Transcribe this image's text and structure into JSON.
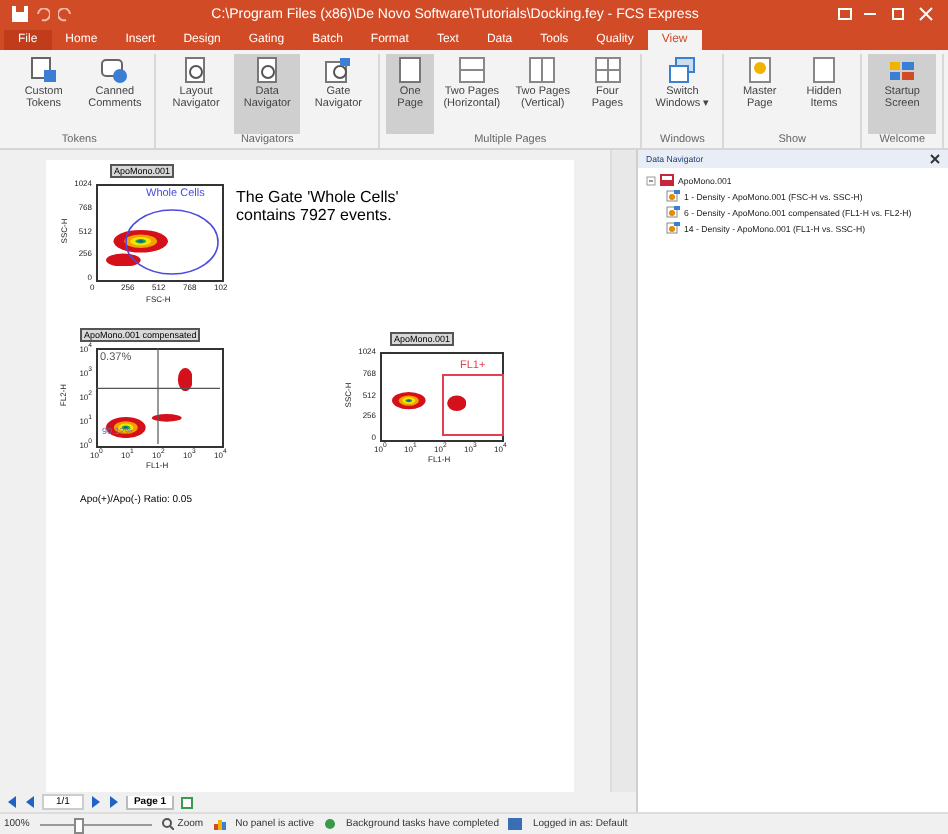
{
  "window": {
    "title": "C:\\Program Files (x86)\\De Novo Software\\Tutorials\\Docking.fey - FCS Express"
  },
  "ribbon_tabs": [
    {
      "label": "File",
      "selected": false
    },
    {
      "label": "Home",
      "selected": false
    },
    {
      "label": "Insert",
      "selected": false
    },
    {
      "label": "Design",
      "selected": false
    },
    {
      "label": "Gating",
      "selected": false
    },
    {
      "label": "Batch",
      "selected": false
    },
    {
      "label": "Format",
      "selected": false
    },
    {
      "label": "Text",
      "selected": false
    },
    {
      "label": "Data",
      "selected": false
    },
    {
      "label": "Tools",
      "selected": false
    },
    {
      "label": "Quality",
      "selected": false
    },
    {
      "label": "View",
      "selected": true
    }
  ],
  "ribbon_groups": [
    {
      "label": "Tokens",
      "buttons": [
        {
          "label": "Custom Tokens",
          "kind": "tokens",
          "selected": false
        },
        {
          "label": "Canned Comments",
          "kind": "comment",
          "selected": false
        }
      ]
    },
    {
      "label": "Navigators",
      "buttons": [
        {
          "label": "Layout Navigator",
          "kind": "navigator",
          "selected": false
        },
        {
          "label": "Data Navigator",
          "kind": "navigator",
          "selected": true
        },
        {
          "label": "Gate Navigator",
          "kind": "gate",
          "selected": false
        }
      ]
    },
    {
      "label": "Multiple Pages",
      "buttons": [
        {
          "label": "One Page",
          "kind": "one",
          "selected": true
        },
        {
          "label": "Two Pages (Horizontal)",
          "kind": "twoh",
          "selected": false
        },
        {
          "label": "Two Pages (Vertical)",
          "kind": "twov",
          "selected": false
        },
        {
          "label": "Four Pages",
          "kind": "four",
          "selected": false
        }
      ]
    },
    {
      "label": "Windows",
      "buttons": [
        {
          "label": "Switch Windows ▾",
          "kind": "windows",
          "selected": false
        }
      ]
    },
    {
      "label": "Show",
      "buttons": [
        {
          "label": "Master Page",
          "kind": "master",
          "selected": false
        },
        {
          "label": "Hidden Items",
          "kind": "hidden",
          "selected": false
        }
      ]
    },
    {
      "label": "Welcome",
      "buttons": [
        {
          "label": "Startup Screen",
          "kind": "startup",
          "selected": true
        }
      ]
    }
  ],
  "document": {
    "plots": [
      {
        "title": "ApoMono.001",
        "ylabel": "SSC-H",
        "xlabel": "FSC-H",
        "yticks": [
          "1024",
          "768",
          "512",
          "256",
          "0"
        ],
        "xticks": [
          "0",
          "256",
          "512",
          "768",
          "102"
        ],
        "gate": {
          "kind": "ellipse",
          "label": "Whole Cells",
          "color": "#4a4adf"
        }
      },
      {
        "title": "ApoMono.001 compensated",
        "ylabel": "FL2-H",
        "xlabel": "FL1-H",
        "yticks": [
          "10$^{4}$",
          "10$^{3}$",
          "10$^{2}$",
          "10$^{1}$",
          "10$^{0}$"
        ],
        "xticks": [
          "10$^{0}$",
          "10$^{1}$",
          "10$^{2}$",
          "10$^{3}$",
          "10$^{4}$"
        ],
        "gate": {
          "kind": "quadrant",
          "label": "0.37%",
          "label_2": "90.12%",
          "color": "#555555"
        }
      },
      {
        "title": "ApoMono.001",
        "ylabel": "SSC-H",
        "xlabel": "FL1-H",
        "yticks": [
          "1024",
          "768",
          "512",
          "256",
          "0"
        ],
        "xticks": [
          "10$^{0}$",
          "10$^{1}$",
          "10$^{2}$",
          "10$^{3}$",
          "10$^{4}$"
        ],
        "gate": {
          "kind": "rectangle",
          "label": "FL1+",
          "color": "#e04050"
        }
      }
    ],
    "gate_text": "The Gate 'Whole Cells' contains 7927 events.",
    "ratio_text": "Apo(+)/Apo(-) Ratio: 0.05"
  },
  "data_navigator": {
    "title": "Data Navigator",
    "tree": [
      {
        "label": "ApoMono.001",
        "expanded": true,
        "children": [
          {
            "label": "1 - Density - ApoMono.001 (FSC-H vs. SSC-H)"
          },
          {
            "label": "6 - Density - ApoMono.001 compensated (FL1-H vs. FL2-H)"
          },
          {
            "label": "14 - Density - ApoMono.001 (FL1-H vs. SSC-H)"
          }
        ]
      }
    ]
  },
  "page_nav": {
    "page_field": "1/1",
    "tab": "Page 1"
  },
  "status_bar": {
    "zoom": "100%",
    "zoom_slider": {
      "level": 0.3
    },
    "zoom_label": "Zoom",
    "panel": "No panel is active",
    "tasks": "Background tasks have completed",
    "login": "Logged in as: Default"
  }
}
